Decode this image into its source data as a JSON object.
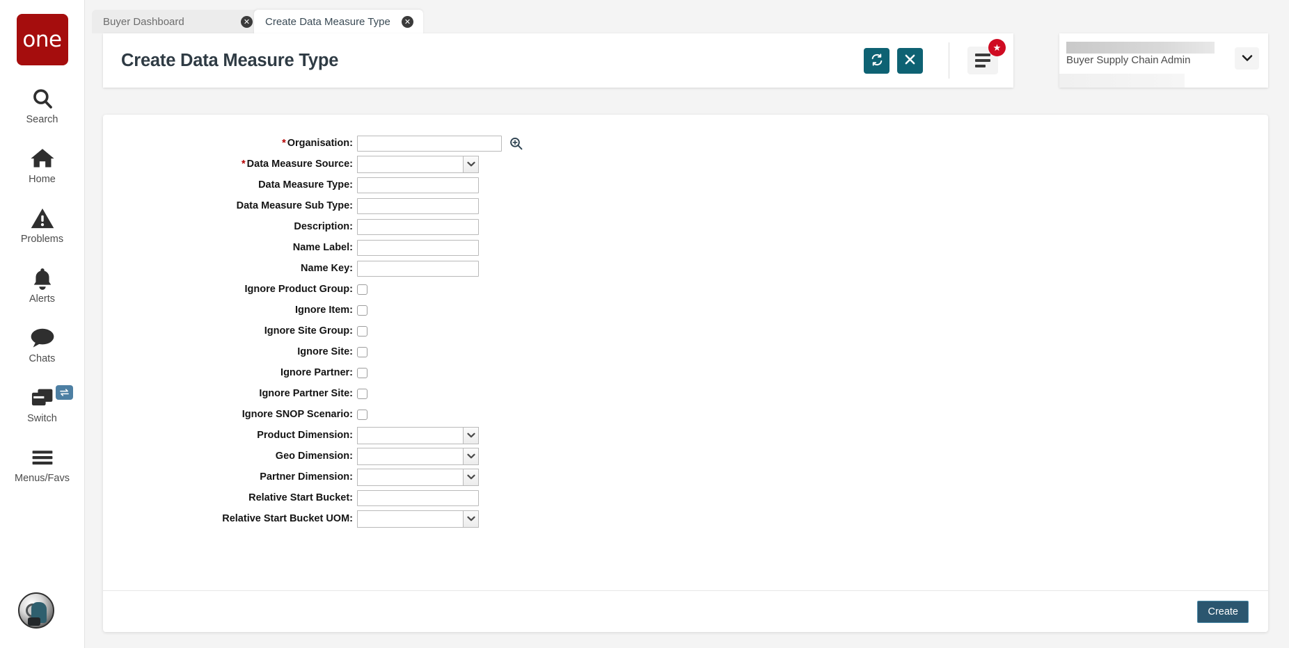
{
  "rail": {
    "logo_text": "one",
    "items": [
      {
        "label": "Search",
        "icon": "search-icon"
      },
      {
        "label": "Home",
        "icon": "home-icon"
      },
      {
        "label": "Problems",
        "icon": "warning-triangle-icon"
      },
      {
        "label": "Alerts",
        "icon": "bell-icon"
      },
      {
        "label": "Chats",
        "icon": "chat-bubble-icon"
      },
      {
        "label": "Switch",
        "icon": "windows-stack-icon",
        "badge_icon": "swap-arrows-icon"
      },
      {
        "label": "Menus/Favs",
        "icon": "hamburger-icon"
      }
    ]
  },
  "tabs": [
    {
      "label": "Buyer Dashboard",
      "active": false,
      "close_icon": "close-circle-icon"
    },
    {
      "label": "Create Data Measure Type",
      "active": true,
      "close_icon": "close-circle-icon"
    }
  ],
  "header": {
    "title": "Create Data Measure Type",
    "refresh_icon": "refresh-sync-icon",
    "close_icon": "close-x-icon",
    "menu_icon": "list-lines-icon",
    "badge_icon": "star-icon",
    "accent_color": "#0e6273",
    "badge_color": "#cf0b22"
  },
  "user": {
    "role": "Buyer Supply Chain Admin",
    "chevron_icon": "chevron-down-icon"
  },
  "form": {
    "fields": [
      {
        "label": "Organisation",
        "required": true,
        "type": "text-lookup",
        "value": "",
        "lookup_icon": "magnifier-plus-icon"
      },
      {
        "label": "Data Measure Source",
        "required": true,
        "type": "select",
        "value": ""
      },
      {
        "label": "Data Measure Type",
        "required": false,
        "type": "text",
        "value": ""
      },
      {
        "label": "Data Measure Sub Type",
        "required": false,
        "type": "text",
        "value": ""
      },
      {
        "label": "Description",
        "required": false,
        "type": "text",
        "value": ""
      },
      {
        "label": "Name Label",
        "required": false,
        "type": "text",
        "value": ""
      },
      {
        "label": "Name Key",
        "required": false,
        "type": "text",
        "value": ""
      },
      {
        "label": "Ignore Product Group",
        "required": false,
        "type": "checkbox",
        "checked": false
      },
      {
        "label": "Ignore Item",
        "required": false,
        "type": "checkbox",
        "checked": false
      },
      {
        "label": "Ignore Site Group",
        "required": false,
        "type": "checkbox",
        "checked": false
      },
      {
        "label": "Ignore Site",
        "required": false,
        "type": "checkbox",
        "checked": false
      },
      {
        "label": "Ignore Partner",
        "required": false,
        "type": "checkbox",
        "checked": false
      },
      {
        "label": "Ignore Partner Site",
        "required": false,
        "type": "checkbox",
        "checked": false
      },
      {
        "label": "Ignore SNOP Scenario",
        "required": false,
        "type": "checkbox",
        "checked": false
      },
      {
        "label": "Product Dimension",
        "required": false,
        "type": "select",
        "value": ""
      },
      {
        "label": "Geo Dimension",
        "required": false,
        "type": "select",
        "value": ""
      },
      {
        "label": "Partner Dimension",
        "required": false,
        "type": "select",
        "value": ""
      },
      {
        "label": "Relative Start Bucket",
        "required": false,
        "type": "text",
        "value": ""
      },
      {
        "label": "Relative Start Bucket UOM",
        "required": false,
        "type": "select",
        "value": ""
      }
    ],
    "submit_label": "Create"
  }
}
